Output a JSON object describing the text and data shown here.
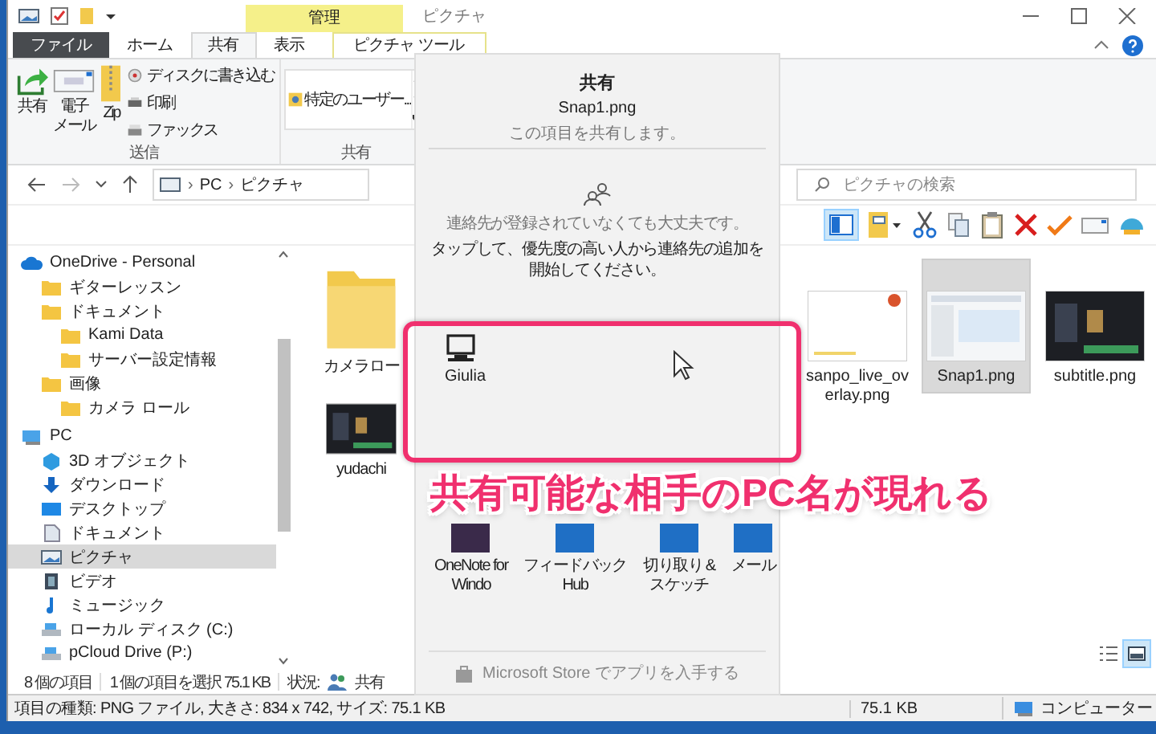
{
  "title_bar": {
    "context_tab": "管理",
    "title": "ピクチャ"
  },
  "ribbon_tabs": [
    {
      "label": "ファイル",
      "kind": "file",
      "selected": false
    },
    {
      "label": "ホーム",
      "kind": "normal",
      "selected": false
    },
    {
      "label": "共有",
      "kind": "normal",
      "selected": true
    },
    {
      "label": "表示",
      "kind": "normal",
      "selected": false
    },
    {
      "label": "ピクチャ ツール",
      "kind": "context",
      "selected": false
    }
  ],
  "ribbon_groups": [
    {
      "label": "送信",
      "large_buttons": [
        {
          "lines": [
            "共有"
          ]
        },
        {
          "lines": [
            "電子",
            "メール"
          ]
        },
        {
          "lines": [
            "Zip"
          ]
        }
      ],
      "small_buttons": [
        "ディスクに書き込む",
        "印刷",
        "ファックス"
      ]
    },
    {
      "label": "共有",
      "gallery_item": "特定のユーザー..."
    }
  ],
  "address_bar": {
    "separator": "›",
    "path": [
      "PC",
      "ピクチャ"
    ],
    "search_placeholder": "ピクチャの検索"
  },
  "sidebar": [
    {
      "label": "OneDrive - Personal",
      "kind": "cloud",
      "selected": false,
      "children": [
        {
          "label": "ギターレッスン",
          "kind": "folder",
          "selected": false
        },
        {
          "label": "ドキュメント",
          "kind": "folder",
          "selected": false,
          "children": [
            {
              "label": "Kami Data",
              "kind": "folder",
              "selected": false
            },
            {
              "label": "サーバー設定情報",
              "kind": "folder",
              "selected": false
            }
          ]
        },
        {
          "label": "画像",
          "kind": "folder",
          "selected": false,
          "children": [
            {
              "label": "カメラ ロール",
              "kind": "folder",
              "selected": false
            }
          ]
        }
      ]
    },
    {
      "label": "PC",
      "kind": "pc",
      "selected": false,
      "children": [
        {
          "label": "3D オブジェクト",
          "kind": "cube",
          "selected": false
        },
        {
          "label": "ダウンロード",
          "kind": "download",
          "selected": false
        },
        {
          "label": "デスクトップ",
          "kind": "desktop",
          "selected": false
        },
        {
          "label": "ドキュメント",
          "kind": "document",
          "selected": false
        },
        {
          "label": "ピクチャ",
          "kind": "pictures",
          "selected": true
        },
        {
          "label": "ビデオ",
          "kind": "video",
          "selected": false
        },
        {
          "label": "ミュージック",
          "kind": "music",
          "selected": false
        },
        {
          "label": "ローカル ディスク (C:)",
          "kind": "drive",
          "selected": false
        },
        {
          "label": "pCloud Drive (P:)",
          "kind": "drive",
          "selected": false
        }
      ]
    }
  ],
  "files_left": [
    {
      "name": "カメラロー",
      "kind": "folder",
      "selected": false
    },
    {
      "name": "yudachi",
      "kind": "dark",
      "selected": false
    }
  ],
  "files_right": [
    {
      "name": "sanpo_live_overlay.png",
      "kind": "light",
      "selected": false
    },
    {
      "name": "Snap1.png",
      "kind": "window",
      "selected": true
    },
    {
      "name": "subtitle.png",
      "kind": "dark",
      "selected": false
    }
  ],
  "status_bar": {
    "item_count": "8 個の項目",
    "selection": "1 個の項目を選択  75.1 KB",
    "state_label": "状況:",
    "state_value": "共有"
  },
  "details_bar": {
    "info": "項目の種類: PNG ファイル, 大きさ: 834 x 742, サイズ: 75.1 KB",
    "size": "75.1 KB",
    "location": "コンピューター"
  },
  "view_buttons": [
    {
      "kind": "details",
      "selected": false
    },
    {
      "kind": "large_icons",
      "selected": true
    }
  ],
  "share_panel": {
    "title": "共有",
    "file": "Snap1.png",
    "subtitle": "この項目を共有します。",
    "contacts_note": "連絡先が登録されていなくても大丈夫です。",
    "contacts_hint": "タップして、優先度の高い人から連絡先の追加を開始してください。",
    "devices": [
      {
        "name": "Giulia"
      }
    ],
    "apps": [
      {
        "name": "OneNote for Windo",
        "color": "#3a2a4a"
      },
      {
        "name": "フィードバック Hub",
        "color": "#1f6fc5"
      },
      {
        "name": "切り取り & スケッチ",
        "color": "#1f6fc5"
      },
      {
        "name": "メール",
        "color": "#1f6fc5"
      }
    ],
    "store_link": "Microsoft Store でアプリを入手する"
  },
  "annotation": {
    "caption": "共有可能な相手のPC名が現れる"
  }
}
